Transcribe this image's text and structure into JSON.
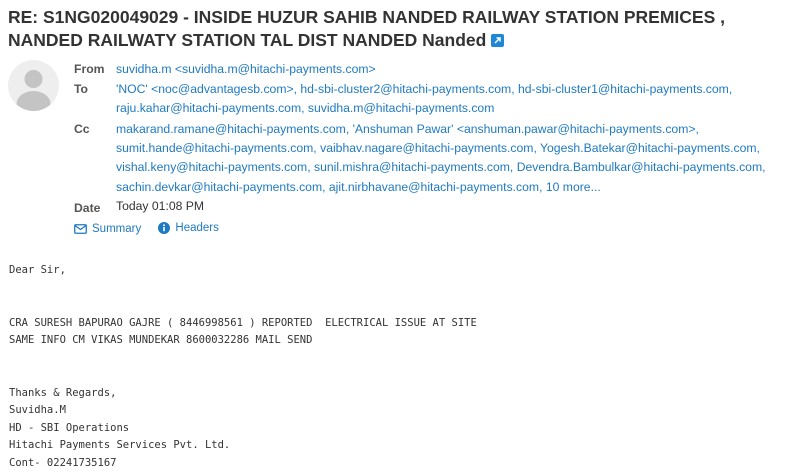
{
  "subject": "RE: S1NG020049029 - INSIDE HUZUR SAHIB NANDED RAILWAY STATION PREMICES , NANDED RAILWATY STATION TAL DIST NANDED Nanded",
  "header": {
    "from_label": "From",
    "to_label": "To",
    "cc_label": "Cc",
    "date_label": "Date",
    "from": "suvidha.m <suvidha.m@hitachi-payments.com>",
    "to": [
      "'NOC' <noc@advantagesb.com>,",
      "hd-sbi-cluster2@hitachi-payments.com,",
      "hd-sbi-cluster1@hitachi-payments.com,",
      "raju.kahar@hitachi-payments.com,",
      "suvidha.m@hitachi-payments.com"
    ],
    "cc": [
      "makarand.ramane@hitachi-payments.com,",
      "'Anshuman Pawar' <anshuman.pawar@hitachi-payments.com>,",
      "sumit.hande@hitachi-payments.com,",
      "vaibhav.nagare@hitachi-payments.com,",
      "Yogesh.Batekar@hitachi-payments.com,",
      "vishal.keny@hitachi-payments.com,",
      "sunil.mishra@hitachi-payments.com,",
      "Devendra.Bambulkar@hitachi-payments.com,",
      "sachin.devkar@hitachi-payments.com,",
      "ajit.nirbhavane@hitachi-payments.com,"
    ],
    "cc_more": "10 more...",
    "date": "Today 01:08 PM"
  },
  "links": {
    "summary": "Summary",
    "headers": "Headers"
  },
  "body": "Dear Sir,\n\n\nCRA SURESH BAPURAO GAJRE ( 8446998561 ) REPORTED  ELECTRICAL ISSUE AT SITE\nSAME INFO CM VIKAS MUNDEKAR 8600032286 MAIL SEND\n\n\nThanks & Regards,\nSuvidha.M\nHD - SBI Operations\nHitachi Payments Services Pvt. Ltd.\nCont- 02241735167",
  "colors": {
    "link": "#1f7ac0",
    "accent": "#1e88d6",
    "text": "#333333"
  }
}
